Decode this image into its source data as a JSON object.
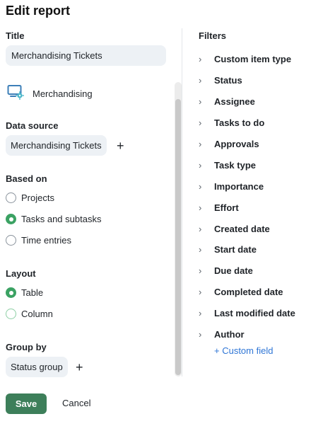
{
  "header": {
    "title": "Edit report"
  },
  "title_section": {
    "label": "Title",
    "value": "Merchandising Tickets"
  },
  "space": {
    "name": "Merchandising",
    "icon": "monitor-gear-icon"
  },
  "data_source": {
    "label": "Data source",
    "chip": "Merchandising Tickets",
    "add": "+"
  },
  "based_on": {
    "label": "Based on",
    "options": [
      "Projects",
      "Tasks and subtasks",
      "Time entries"
    ],
    "selected": "Tasks and subtasks"
  },
  "layout": {
    "label": "Layout",
    "options": [
      "Table",
      "Column"
    ],
    "selected": "Table"
  },
  "group_by": {
    "label": "Group by",
    "chip": "Status group",
    "add": "+"
  },
  "filters": {
    "label": "Filters",
    "items": [
      "Custom item type",
      "Status",
      "Assignee",
      "Tasks to do",
      "Approvals",
      "Task type",
      "Importance",
      "Effort",
      "Created date",
      "Start date",
      "Due date",
      "Completed date",
      "Last modified date",
      "Author"
    ],
    "custom_field": "+ Custom field"
  },
  "footer": {
    "save": "Save",
    "cancel": "Cancel"
  },
  "colors": {
    "accent": "#3ba263",
    "save_bg": "#3d7f5a",
    "link": "#2f76d6",
    "chip_bg": "#edf1f5"
  }
}
